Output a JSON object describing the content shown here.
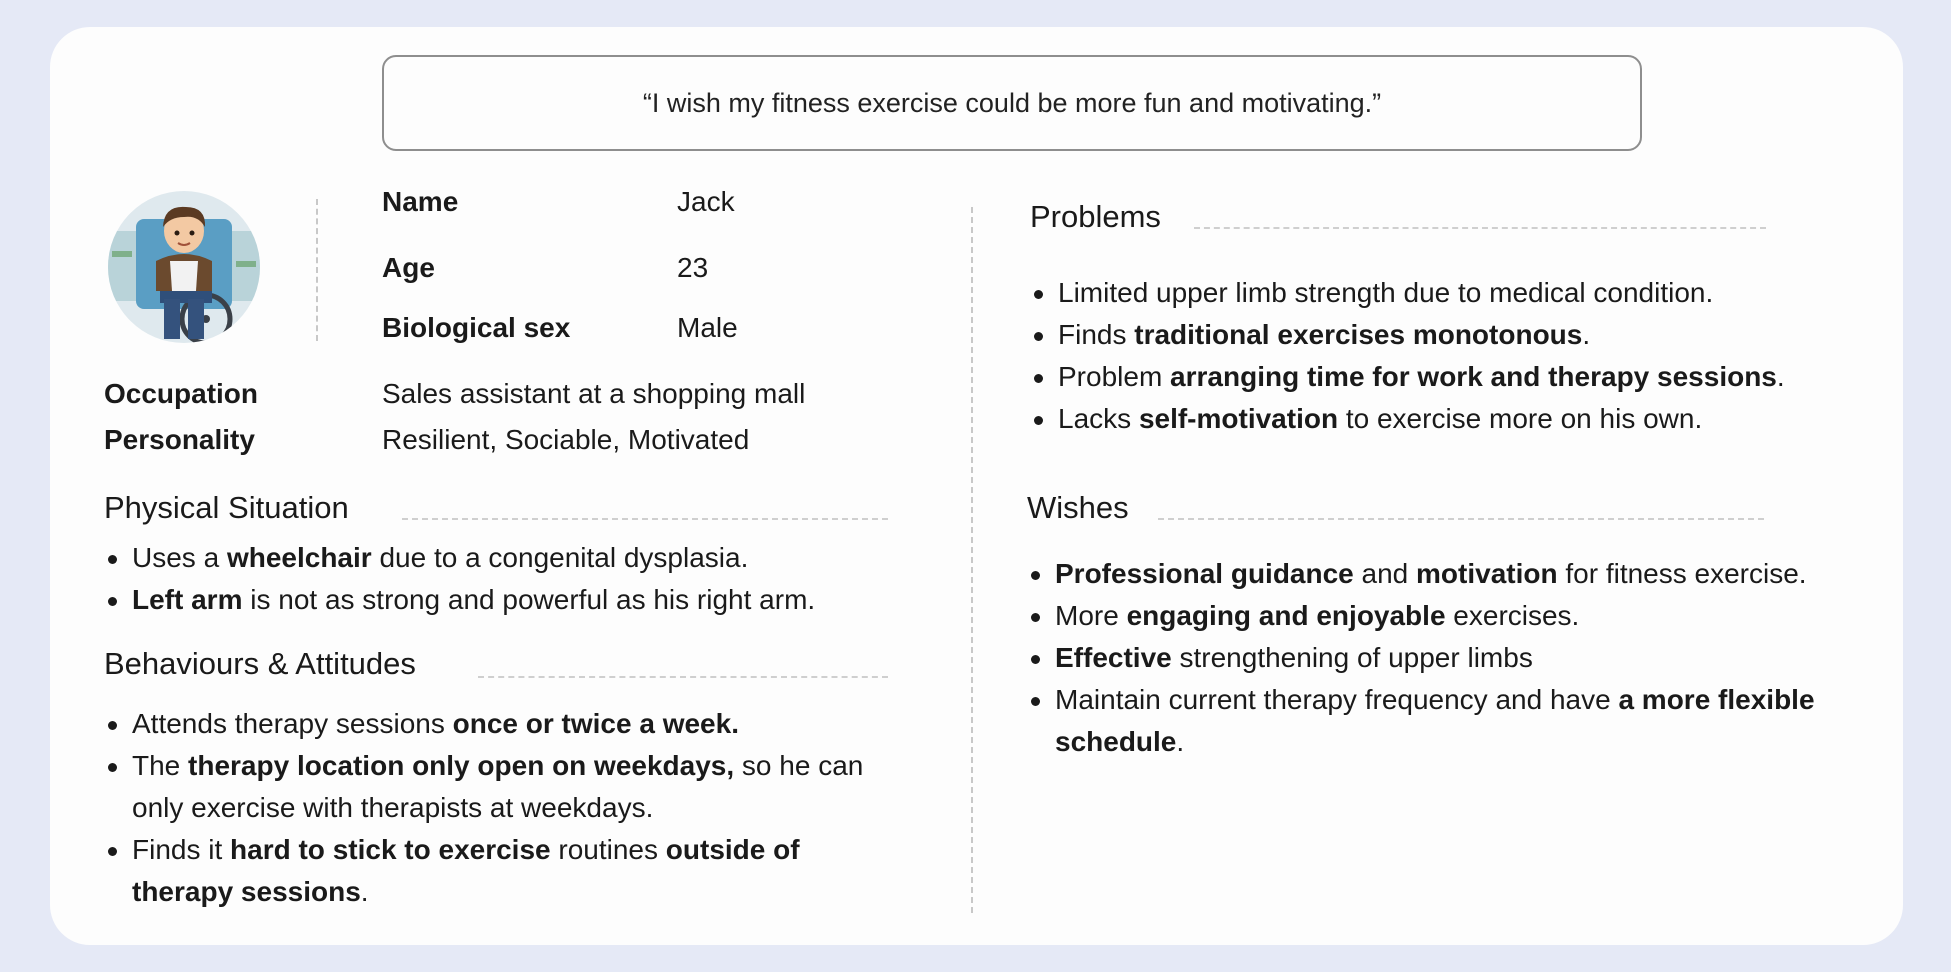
{
  "quote": "“I wish my fitness exercise could be more fun and motivating.”",
  "profile": {
    "name_label": "Name",
    "name_value": "Jack",
    "age_label": "Age",
    "age_value": "23",
    "sex_label": "Biological sex",
    "sex_value": "Male",
    "occupation_label": "Occupation",
    "occupation_value": "Sales assistant at a shopping mall",
    "personality_label": "Personality",
    "personality_value": "Resilient, Sociable, Motivated"
  },
  "physical": {
    "heading": "Physical Situation",
    "items": [
      [
        {
          "t": "Uses a "
        },
        {
          "t": "wheelchair",
          "b": true
        },
        {
          "t": " due to a congenital dysplasia."
        }
      ],
      [
        {
          "t": "Left arm",
          "b": true
        },
        {
          "t": " is not as strong and powerful as his right arm."
        }
      ]
    ]
  },
  "behaviours": {
    "heading": "Behaviours & Attitudes",
    "items": [
      [
        {
          "t": "Attends therapy sessions "
        },
        {
          "t": "once or twice a week.",
          "b": true
        }
      ],
      [
        {
          "t": "The "
        },
        {
          "t": "therapy location only open on weekdays,",
          "b": true
        },
        {
          "t": " so he can only exercise with therapists at weekdays."
        }
      ],
      [
        {
          "t": "Finds it "
        },
        {
          "t": "hard to stick to exercise",
          "b": true
        },
        {
          "t": " routines "
        },
        {
          "t": "outside of therapy sessions",
          "b": true
        },
        {
          "t": "."
        }
      ]
    ]
  },
  "problems": {
    "heading": "Problems",
    "items": [
      [
        {
          "t": "Limited upper limb strength due to medical condition."
        }
      ],
      [
        {
          "t": "Finds "
        },
        {
          "t": "traditional exercises monotonous",
          "b": true
        },
        {
          "t": "."
        }
      ],
      [
        {
          "t": "Problem "
        },
        {
          "t": "arranging time for work and therapy sessions",
          "b": true
        },
        {
          "t": "."
        }
      ],
      [
        {
          "t": "Lacks "
        },
        {
          "t": "self-motivation",
          "b": true
        },
        {
          "t": " to exercise more on his own."
        }
      ]
    ]
  },
  "wishes": {
    "heading": "Wishes",
    "items": [
      [
        {
          "t": "Professional guidance",
          "b": true
        },
        {
          "t": " and "
        },
        {
          "t": "motivation",
          "b": true
        },
        {
          "t": " for fitness exercise."
        }
      ],
      [
        {
          "t": "More "
        },
        {
          "t": "engaging and enjoyable",
          "b": true
        },
        {
          "t": " exercises."
        }
      ],
      [
        {
          "t": "Effective",
          "b": true
        },
        {
          "t": " strengthening of upper limbs"
        }
      ],
      [
        {
          "t": "Maintain current therapy frequency and have "
        },
        {
          "t": "a more flexible schedule",
          "b": true
        },
        {
          "t": "."
        }
      ]
    ]
  },
  "avatar_icon": "wheelchair-user-avatar-icon",
  "colors": {
    "page_bg": "#e5e9f6",
    "card_bg": "#fdfdfd",
    "quote_border": "#8e8e8e"
  }
}
